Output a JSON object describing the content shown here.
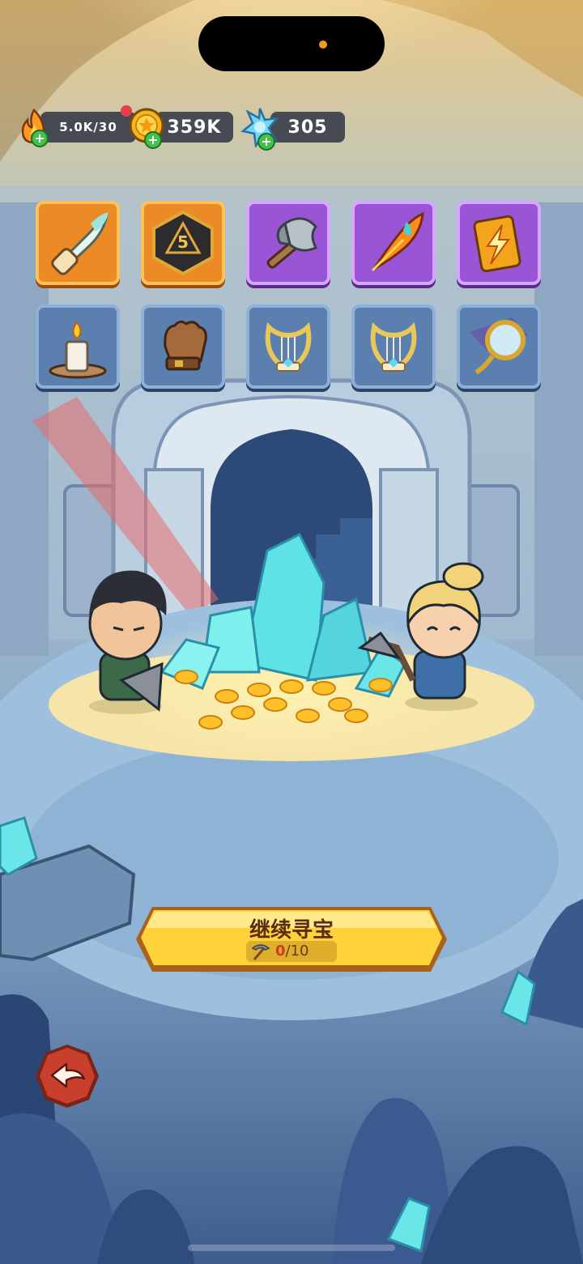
{
  "resources": {
    "stamina": {
      "icon": "flame-icon",
      "value": "5.0K/30"
    },
    "gold": {
      "icon": "gold-coin-icon",
      "value": "359K"
    },
    "gems": {
      "icon": "blue-crystal-icon",
      "value": "305"
    }
  },
  "items_row1": [
    {
      "icon": "feather-scroll-icon",
      "rarity": "orange"
    },
    {
      "icon": "d20-dice-icon",
      "rarity": "orange"
    },
    {
      "icon": "battle-axe-icon",
      "rarity": "purple"
    },
    {
      "icon": "phoenix-feather-icon",
      "rarity": "purple"
    },
    {
      "icon": "lightning-card-icon",
      "rarity": "purple"
    }
  ],
  "items_row2": [
    {
      "icon": "candle-icon",
      "rarity": "blue"
    },
    {
      "icon": "leather-glove-icon",
      "rarity": "blue"
    },
    {
      "icon": "lyre-icon",
      "rarity": "blue"
    },
    {
      "icon": "lyre-icon",
      "rarity": "blue"
    },
    {
      "icon": "magnifying-glass-icon",
      "rarity": "blue"
    }
  ],
  "main_button": {
    "label": "继续寻宝",
    "counter_current": "0",
    "counter_total": "/10",
    "counter_icon": "pickaxe-icon"
  },
  "back_button": {
    "icon": "back-arrow-icon"
  },
  "colors": {
    "button_gold": "#ffd23a",
    "slot_orange": "#ec8a26",
    "slot_purple": "#9a55d6",
    "slot_blue": "#5b7fae",
    "back_red": "#c8402d"
  }
}
